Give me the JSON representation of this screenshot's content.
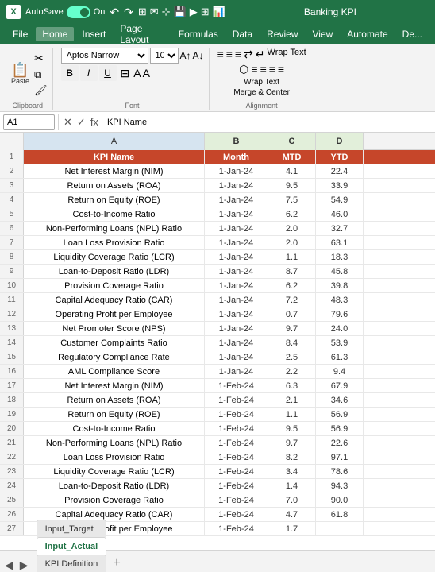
{
  "titleBar": {
    "excelLabel": "X",
    "autoSaveLabel": "AutoSave",
    "autoSaveOn": "On",
    "undoIcon": "↶",
    "redoIcon": "↷",
    "title": "Banking KPI",
    "icons": [
      "⊞",
      "📧",
      "🖱️",
      "📋",
      "▶",
      "🔲",
      "📊"
    ]
  },
  "menuBar": {
    "items": [
      "File",
      "Home",
      "Insert",
      "Page Layout",
      "Formulas",
      "Data",
      "Review",
      "View",
      "Automate",
      "De..."
    ],
    "active": "Home"
  },
  "ribbon": {
    "clipboard": {
      "label": "Clipboard",
      "pasteLabel": "Paste"
    },
    "font": {
      "label": "Font",
      "fontName": "Aptos Narrow",
      "fontSize": "10",
      "bold": "B",
      "italic": "I",
      "underline": "U"
    },
    "alignment": {
      "label": "Alignment",
      "wrapText": "Wrap Text",
      "mergeCenter": "Merge & Center"
    }
  },
  "formulaBar": {
    "cellRef": "A1",
    "cancelIcon": "✕",
    "confirmIcon": "✓",
    "formulaIcon": "fx",
    "value": "KPI Name"
  },
  "columns": {
    "rowNum": "#",
    "a": "A",
    "b": "B",
    "c": "C",
    "d": "D"
  },
  "headers": {
    "kpiName": "KPI Name",
    "month": "Month",
    "mtd": "MTD",
    "ytd": "YTD"
  },
  "rows": [
    {
      "num": "2",
      "kpi": "Net Interest Margin (NIM)",
      "month": "1-Jan-24",
      "mtd": "4.1",
      "ytd": "22.4"
    },
    {
      "num": "3",
      "kpi": "Return on Assets (ROA)",
      "month": "1-Jan-24",
      "mtd": "9.5",
      "ytd": "33.9"
    },
    {
      "num": "4",
      "kpi": "Return on Equity (ROE)",
      "month": "1-Jan-24",
      "mtd": "7.5",
      "ytd": "54.9"
    },
    {
      "num": "5",
      "kpi": "Cost-to-Income Ratio",
      "month": "1-Jan-24",
      "mtd": "6.2",
      "ytd": "46.0"
    },
    {
      "num": "6",
      "kpi": "Non-Performing Loans (NPL) Ratio",
      "month": "1-Jan-24",
      "mtd": "2.0",
      "ytd": "32.7"
    },
    {
      "num": "7",
      "kpi": "Loan Loss Provision Ratio",
      "month": "1-Jan-24",
      "mtd": "2.0",
      "ytd": "63.1"
    },
    {
      "num": "8",
      "kpi": "Liquidity Coverage Ratio (LCR)",
      "month": "1-Jan-24",
      "mtd": "1.1",
      "ytd": "18.3"
    },
    {
      "num": "9",
      "kpi": "Loan-to-Deposit Ratio (LDR)",
      "month": "1-Jan-24",
      "mtd": "8.7",
      "ytd": "45.8"
    },
    {
      "num": "10",
      "kpi": "Provision Coverage Ratio",
      "month": "1-Jan-24",
      "mtd": "6.2",
      "ytd": "39.8"
    },
    {
      "num": "11",
      "kpi": "Capital Adequacy Ratio (CAR)",
      "month": "1-Jan-24",
      "mtd": "7.2",
      "ytd": "48.3"
    },
    {
      "num": "12",
      "kpi": "Operating Profit per Employee",
      "month": "1-Jan-24",
      "mtd": "0.7",
      "ytd": "79.6"
    },
    {
      "num": "13",
      "kpi": "Net Promoter Score (NPS)",
      "month": "1-Jan-24",
      "mtd": "9.7",
      "ytd": "24.0"
    },
    {
      "num": "14",
      "kpi": "Customer Complaints Ratio",
      "month": "1-Jan-24",
      "mtd": "8.4",
      "ytd": "53.9"
    },
    {
      "num": "15",
      "kpi": "Regulatory Compliance Rate",
      "month": "1-Jan-24",
      "mtd": "2.5",
      "ytd": "61.3"
    },
    {
      "num": "16",
      "kpi": "AML Compliance Score",
      "month": "1-Jan-24",
      "mtd": "2.2",
      "ytd": "9.4"
    },
    {
      "num": "17",
      "kpi": "Net Interest Margin (NIM)",
      "month": "1-Feb-24",
      "mtd": "6.3",
      "ytd": "67.9"
    },
    {
      "num": "18",
      "kpi": "Return on Assets (ROA)",
      "month": "1-Feb-24",
      "mtd": "2.1",
      "ytd": "34.6"
    },
    {
      "num": "19",
      "kpi": "Return on Equity (ROE)",
      "month": "1-Feb-24",
      "mtd": "1.1",
      "ytd": "56.9"
    },
    {
      "num": "20",
      "kpi": "Cost-to-Income Ratio",
      "month": "1-Feb-24",
      "mtd": "9.5",
      "ytd": "56.9"
    },
    {
      "num": "21",
      "kpi": "Non-Performing Loans (NPL) Ratio",
      "month": "1-Feb-24",
      "mtd": "9.7",
      "ytd": "22.6"
    },
    {
      "num": "22",
      "kpi": "Loan Loss Provision Ratio",
      "month": "1-Feb-24",
      "mtd": "8.2",
      "ytd": "97.1"
    },
    {
      "num": "23",
      "kpi": "Liquidity Coverage Ratio (LCR)",
      "month": "1-Feb-24",
      "mtd": "3.4",
      "ytd": "78.6"
    },
    {
      "num": "24",
      "kpi": "Loan-to-Deposit Ratio (LDR)",
      "month": "1-Feb-24",
      "mtd": "1.4",
      "ytd": "94.3"
    },
    {
      "num": "25",
      "kpi": "Provision Coverage Ratio",
      "month": "1-Feb-24",
      "mtd": "7.0",
      "ytd": "90.0"
    },
    {
      "num": "26",
      "kpi": "Capital Adequacy Ratio (CAR)",
      "month": "1-Feb-24",
      "mtd": "4.7",
      "ytd": "61.8"
    },
    {
      "num": "27",
      "kpi": "Operating Profit per Employee",
      "month": "1-Feb-24",
      "mtd": "1.7",
      "ytd": ""
    }
  ],
  "tabs": {
    "sheets": [
      "Input_Target",
      "Input_Actual",
      "KPI Definition"
    ],
    "active": "Input_Actual",
    "addLabel": "+"
  }
}
